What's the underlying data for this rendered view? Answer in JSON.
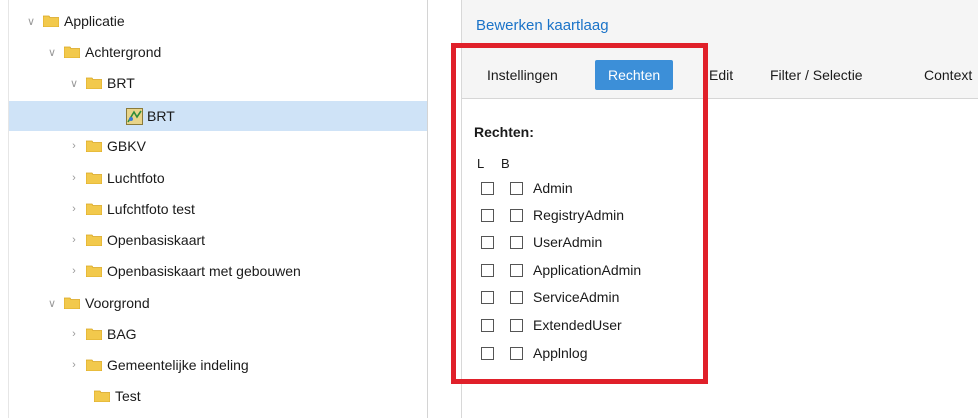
{
  "tree": {
    "nodes": [
      {
        "label": "Applicatie",
        "expand": "down"
      },
      {
        "label": "Achtergrond",
        "expand": "down"
      },
      {
        "label": "BRT",
        "expand": "down"
      },
      {
        "label": "BRT",
        "expand": "none",
        "type": "layer",
        "selected": true
      },
      {
        "label": "GBKV",
        "expand": "right"
      },
      {
        "label": "Luchtfoto",
        "expand": "right"
      },
      {
        "label": "Lufchtfoto test",
        "expand": "right"
      },
      {
        "label": "Openbasiskaart",
        "expand": "right"
      },
      {
        "label": "Openbasiskaart met gebouwen",
        "expand": "right"
      },
      {
        "label": "Voorgrond",
        "expand": "down"
      },
      {
        "label": "BAG",
        "expand": "right"
      },
      {
        "label": "Gemeentelijke indeling",
        "expand": "right"
      },
      {
        "label": "Test",
        "expand": "none"
      }
    ]
  },
  "panel": {
    "title": "Bewerken kaartlaag",
    "tabs": [
      {
        "label": "Instellingen"
      },
      {
        "label": "Rechten",
        "active": true
      },
      {
        "label": "Edit"
      },
      {
        "label": "Filter / Selectie"
      },
      {
        "label": "Context"
      }
    ]
  },
  "rights": {
    "title": "Rechten:",
    "col_l": "L",
    "col_b": "B",
    "rows": [
      {
        "label": "Admin"
      },
      {
        "label": "RegistryAdmin"
      },
      {
        "label": "UserAdmin"
      },
      {
        "label": "ApplicationAdmin"
      },
      {
        "label": "ServiceAdmin"
      },
      {
        "label": "ExtendedUser"
      },
      {
        "label": "Applnlog"
      }
    ]
  },
  "colors": {
    "accent": "#3c8fd8",
    "title": "#1a73c8",
    "selection": "#cfe3f7",
    "highlight": "#e0202a",
    "folder": "#f2c94c"
  }
}
